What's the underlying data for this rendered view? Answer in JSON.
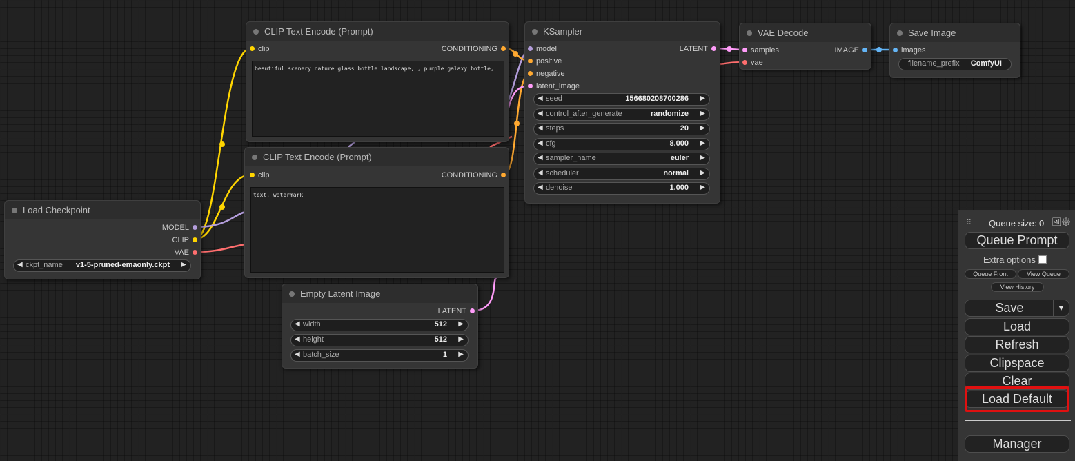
{
  "nodes": {
    "load_checkpoint": {
      "title": "Load Checkpoint",
      "outputs": [
        "MODEL",
        "CLIP",
        "VAE"
      ],
      "widget": {
        "label": "ckpt_name",
        "value": "v1-5-pruned-emaonly.ckpt"
      }
    },
    "clip_positive": {
      "title": "CLIP Text Encode (Prompt)",
      "input": "clip",
      "output": "CONDITIONING",
      "text": "beautiful scenery nature glass bottle landscape, , purple galaxy bottle,"
    },
    "clip_negative": {
      "title": "CLIP Text Encode (Prompt)",
      "input": "clip",
      "output": "CONDITIONING",
      "text": "text, watermark"
    },
    "empty_latent": {
      "title": "Empty Latent Image",
      "output": "LATENT",
      "widgets": [
        {
          "label": "width",
          "value": "512"
        },
        {
          "label": "height",
          "value": "512"
        },
        {
          "label": "batch_size",
          "value": "1"
        }
      ]
    },
    "ksampler": {
      "title": "KSampler",
      "inputs": [
        "model",
        "positive",
        "negative",
        "latent_image"
      ],
      "output": "LATENT",
      "widgets": [
        {
          "label": "seed",
          "value": "156680208700286"
        },
        {
          "label": "control_after_generate",
          "value": "randomize"
        },
        {
          "label": "steps",
          "value": "20"
        },
        {
          "label": "cfg",
          "value": "8.000"
        },
        {
          "label": "sampler_name",
          "value": "euler"
        },
        {
          "label": "scheduler",
          "value": "normal"
        },
        {
          "label": "denoise",
          "value": "1.000"
        }
      ]
    },
    "vae_decode": {
      "title": "VAE Decode",
      "inputs": [
        "samples",
        "vae"
      ],
      "output": "IMAGE"
    },
    "save_image": {
      "title": "Save Image",
      "input": "images",
      "widget": {
        "label": "filename_prefix",
        "value": "ComfyUI"
      }
    }
  },
  "menu": {
    "queue_size": "Queue size: 0",
    "queue_prompt": "Queue Prompt",
    "extra_options": "Extra options",
    "queue_front": "Queue Front",
    "view_queue": "View Queue",
    "view_history": "View History",
    "save": "Save",
    "load": "Load",
    "refresh": "Refresh",
    "clipspace": "Clipspace",
    "clear": "Clear",
    "load_default": "Load Default",
    "manager": "Manager"
  },
  "colors": {
    "model": "#b39ddb",
    "clip": "#ffd500",
    "vae": "#ff6e6e",
    "conditioning": "#ffa931",
    "latent": "#ff9cf9",
    "image": "#64b5f6",
    "highlight": "#e01010"
  },
  "icons": {
    "arrow_left": "◀",
    "arrow_right": "▶",
    "dropdown": "▼",
    "drag_handle": "⠿",
    "image_icon": "🖼",
    "settings_icon": "⚙"
  }
}
